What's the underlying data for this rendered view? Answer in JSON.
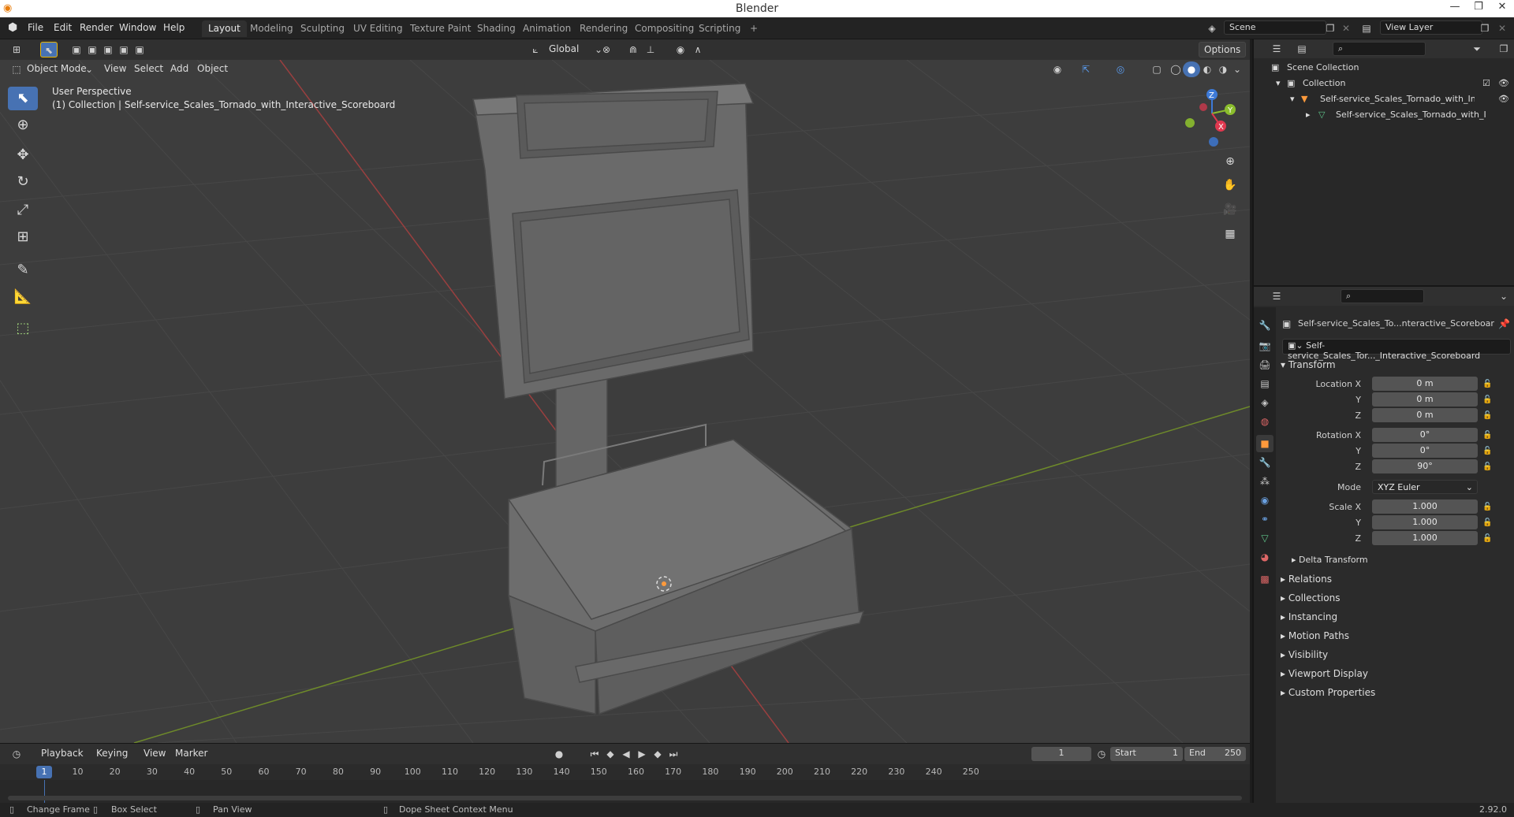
{
  "window": {
    "title": "Blender",
    "minimize": "—",
    "restore": "❐",
    "close": "✕"
  },
  "menu": [
    "File",
    "Edit",
    "Render",
    "Window",
    "Help"
  ],
  "workspaces": [
    "Layout",
    "Modeling",
    "Sculpting",
    "UV Editing",
    "Texture Paint",
    "Shading",
    "Animation",
    "Rendering",
    "Compositing",
    "Scripting"
  ],
  "add_workspace": "+",
  "scene": {
    "name": "Scene",
    "view_layer": "View Layer"
  },
  "viewport_header": {
    "orientation": "Global",
    "options": "Options",
    "mode": "Object Mode",
    "menus": [
      "View",
      "Select",
      "Add",
      "Object"
    ]
  },
  "viewport": {
    "perspective": "User Perspective",
    "collection_info": "(1) Collection | Self-service_Scales_Tornado_with_Interactive_Scoreboard",
    "axes": {
      "x": "X",
      "y": "Y",
      "z": "Z"
    }
  },
  "outliner": {
    "scene_collection": "Scene Collection",
    "collection": "Collection",
    "object": "Self-service_Scales_Tornado_with_Intera",
    "mesh": "Self-service_Scales_Tornado_with_In"
  },
  "properties": {
    "object_name": "Self-service_Scales_To...nteractive_Scoreboar",
    "object_field": "Self-service_Scales_Tor..._Interactive_Scoreboard",
    "transform_label": "Transform",
    "location": {
      "label_x": "Location X",
      "label_y": "Y",
      "label_z": "Z",
      "x": "0 m",
      "y": "0 m",
      "z": "0 m"
    },
    "rotation": {
      "label_x": "Rotation X",
      "label_y": "Y",
      "label_z": "Z",
      "x": "0°",
      "y": "0°",
      "z": "90°"
    },
    "mode_label": "Mode",
    "mode_value": "XYZ Euler",
    "scale": {
      "label_x": "Scale X",
      "label_y": "Y",
      "label_z": "Z",
      "x": "1.000",
      "y": "1.000",
      "z": "1.000"
    },
    "delta_transform": "Delta Transform",
    "sections": [
      "Relations",
      "Collections",
      "Instancing",
      "Motion Paths",
      "Visibility",
      "Viewport Display",
      "Custom Properties"
    ]
  },
  "timeline": {
    "menus": [
      "Playback",
      "Keying",
      "View",
      "Marker"
    ],
    "current_frame": "1",
    "start_label": "Start",
    "start": "1",
    "end_label": "End",
    "end": "250",
    "ticks": [
      "1",
      "10",
      "20",
      "30",
      "40",
      "50",
      "60",
      "70",
      "80",
      "90",
      "100",
      "110",
      "120",
      "130",
      "140",
      "150",
      "160",
      "170",
      "180",
      "190",
      "200",
      "210",
      "220",
      "230",
      "240",
      "250"
    ]
  },
  "status": {
    "change_frame": "Change Frame",
    "box_select": "Box Select",
    "pan_view": "Pan View",
    "context_menu": "Dope Sheet Context Menu",
    "version": "2.92.0"
  }
}
